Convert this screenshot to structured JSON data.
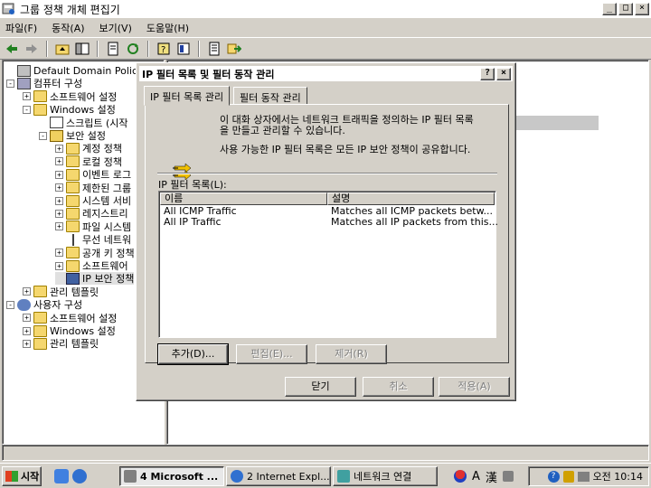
{
  "window": {
    "title": "그룹 정책 개체 편집기"
  },
  "window_buttons": {
    "minimize": "_",
    "maximize": "□",
    "close": "×"
  },
  "menu": [
    "파일(F)",
    "동작(A)",
    "보기(V)",
    "도움말(H)"
  ],
  "tree": [
    {
      "label": "Default Domain Policy [l",
      "depth": 0,
      "expander": "",
      "icon": "policy-icon"
    },
    {
      "label": "컴퓨터 구성",
      "depth": 0,
      "expander": "-",
      "icon": "computer-icon"
    },
    {
      "label": "소프트웨어 설정",
      "depth": 1,
      "expander": "+",
      "icon": "folder-icon"
    },
    {
      "label": "Windows 설정",
      "depth": 1,
      "expander": "-",
      "icon": "folder-icon"
    },
    {
      "label": "스크립트 (시작",
      "depth": 2,
      "expander": "",
      "icon": "script-icon"
    },
    {
      "label": "보안 설정",
      "depth": 2,
      "expander": "-",
      "icon": "security-icon"
    },
    {
      "label": "계정 정책",
      "depth": 3,
      "expander": "+",
      "icon": "folder-icon"
    },
    {
      "label": "로컬 정책",
      "depth": 3,
      "expander": "+",
      "icon": "folder-icon"
    },
    {
      "label": "이벤트 로그",
      "depth": 3,
      "expander": "+",
      "icon": "folder-icon"
    },
    {
      "label": "제한된 그룹",
      "depth": 3,
      "expander": "+",
      "icon": "folder-icon"
    },
    {
      "label": "시스템 서비",
      "depth": 3,
      "expander": "+",
      "icon": "folder-icon"
    },
    {
      "label": "레지스트리",
      "depth": 3,
      "expander": "+",
      "icon": "folder-icon"
    },
    {
      "label": "파일 시스템",
      "depth": 3,
      "expander": "+",
      "icon": "folder-icon"
    },
    {
      "label": "무선 네트워",
      "depth": 3,
      "expander": "",
      "icon": "antenna-icon"
    },
    {
      "label": "공개 키 정책",
      "depth": 3,
      "expander": "+",
      "icon": "folder-icon"
    },
    {
      "label": "소프트웨어",
      "depth": 3,
      "expander": "+",
      "icon": "folder-icon"
    },
    {
      "label": "IP 보안 정책",
      "depth": 3,
      "expander": "",
      "icon": "ip-security-icon",
      "selected": true
    },
    {
      "label": "관리 템플릿",
      "depth": 1,
      "expander": "+",
      "icon": "folder-icon"
    },
    {
      "label": "사용자 구성",
      "depth": 0,
      "expander": "-",
      "icon": "user-icon"
    },
    {
      "label": "소프트웨어 설정",
      "depth": 1,
      "expander": "+",
      "icon": "folder-icon"
    },
    {
      "label": "Windows 설정",
      "depth": 1,
      "expander": "+",
      "icon": "folder-icon"
    },
    {
      "label": "관리 템플릿",
      "depth": 1,
      "expander": "+",
      "icon": "folder-icon"
    }
  ],
  "dialog": {
    "title": "IP 필터 목록 및 필터 동작 관리",
    "help_btn": "?",
    "close_btn": "×",
    "tabs": [
      "IP 필터 목록 관리",
      "필터 동작 관리"
    ],
    "desc1_line1": "이 대화 상자에서는 네트워크 트래픽을 정의하는 IP 필터 목록",
    "desc1_line2": "을 만들고 관리할 수 있습니다.",
    "desc2": "사용 가능한 IP 필터 목록은 모든 IP 보안 정책이 공유합니다.",
    "list_label": "IP 필터 목록(L):",
    "columns": [
      "이름",
      "설명"
    ],
    "rows": [
      {
        "name": "All ICMP Traffic",
        "desc": "Matches all ICMP packets betw..."
      },
      {
        "name": "All IP Traffic",
        "desc": "Matches all IP packets from this..."
      }
    ],
    "add_btn": "추가(D)...",
    "edit_btn": "편집(E)...",
    "remove_btn": "제거(R)",
    "close_btn_label": "닫기",
    "cancel_btn": "취소",
    "apply_btn": "적용(A)"
  },
  "taskbar": {
    "start": "시작",
    "tasks": [
      "4 Microsoft ...",
      "2 Internet Expl...",
      "네트워크 연결"
    ],
    "ime": [
      "A",
      "漢"
    ],
    "clock": "오전 10:14"
  }
}
